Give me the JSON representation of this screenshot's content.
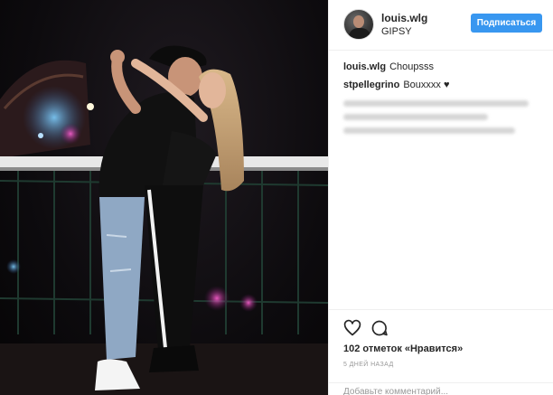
{
  "post": {
    "username": "louis.wlg",
    "location": "GIPSY",
    "follow_label": "Подписаться",
    "caption": {
      "username": "louis.wlg",
      "text": "Choupsss"
    },
    "comments": [
      {
        "username": "stpellegrino",
        "text": "Bouxxxx ♥"
      }
    ],
    "likes": "102 отметок «Нравится»",
    "time": "5 дней назад",
    "add_comment_placeholder": "Добавьте комментарий..."
  },
  "icons": {
    "like": "heart-icon",
    "comment": "comment-icon"
  },
  "colors": {
    "accent": "#3897f0",
    "text": "#262626",
    "muted": "#999999",
    "divider": "#efefef"
  }
}
